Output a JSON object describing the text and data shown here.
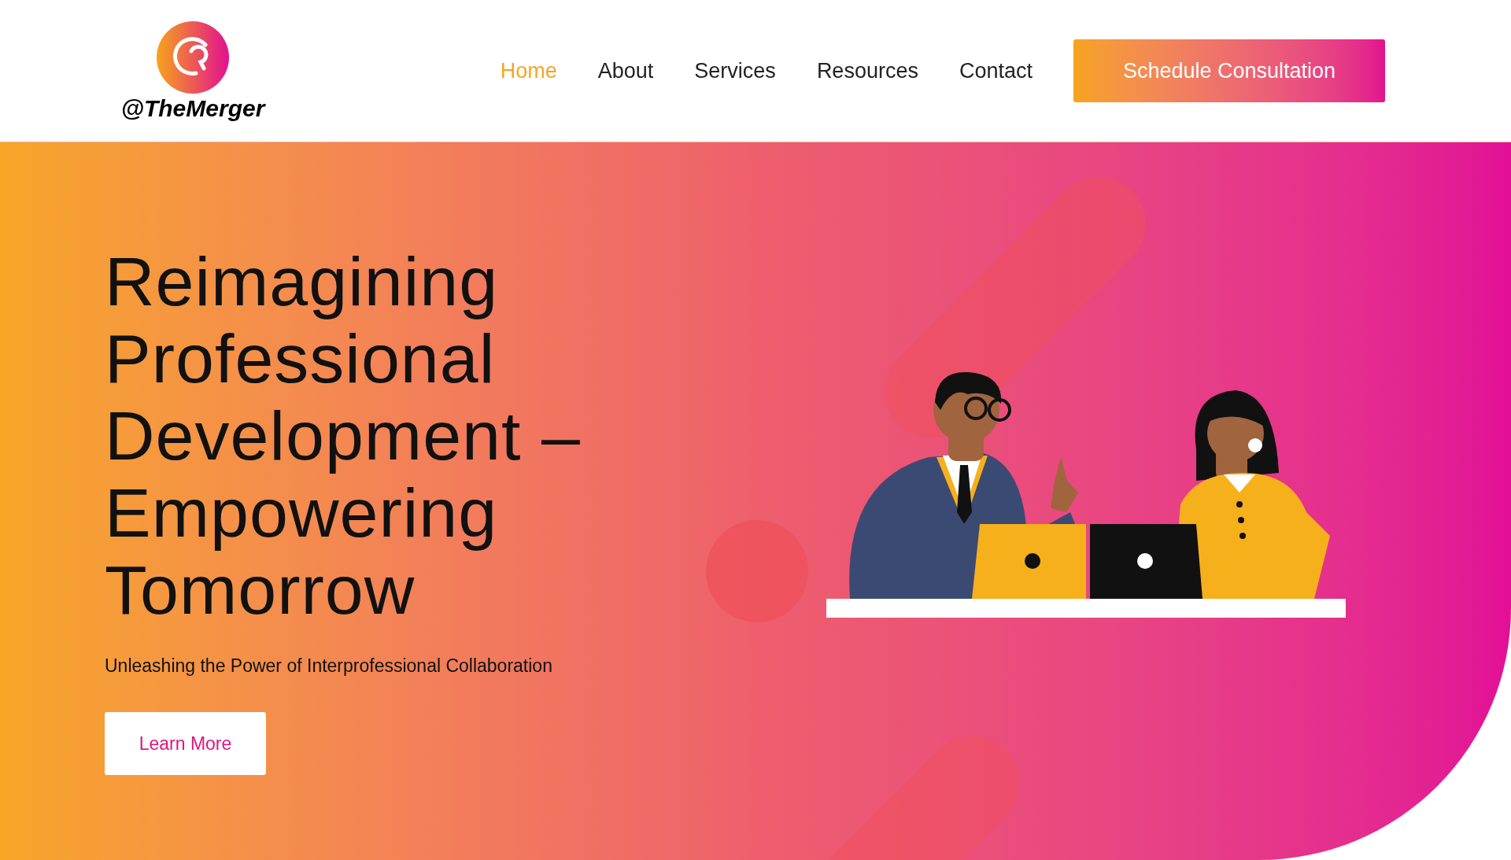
{
  "logo": {
    "text": "@TheMerger"
  },
  "nav": [
    {
      "label": "Home",
      "selected": true
    },
    {
      "label": "About",
      "selected": false
    },
    {
      "label": "Services",
      "selected": false
    },
    {
      "label": "Resources",
      "selected": false
    },
    {
      "label": "Contact",
      "selected": false
    }
  ],
  "cta": {
    "label": "Schedule Consultation"
  },
  "hero": {
    "heading_lines": [
      "Reimagining",
      "Professional",
      "Development –",
      "Empowering",
      "Tomorrow"
    ],
    "subtitle": "Unleashing the Power of Interprofessional Collaboration",
    "button": "Learn More"
  }
}
